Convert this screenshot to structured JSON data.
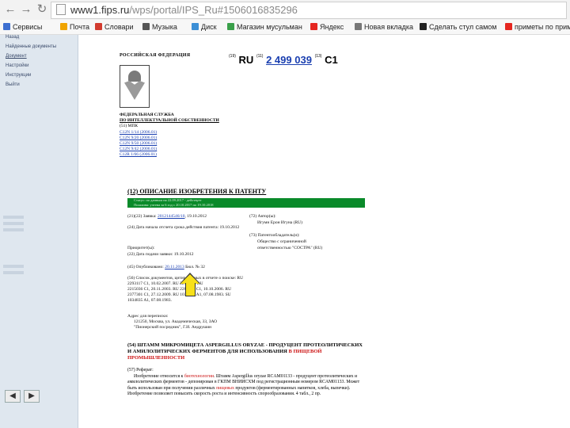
{
  "browser": {
    "url_host": "www1.fips.ru",
    "url_path": "/wps/portal/IPS_Ru#1506016835296",
    "bookmarks": [
      {
        "label": "Сервисы",
        "color": "#3d6fd1"
      },
      {
        "label": "Почта",
        "color": "#f0a400"
      },
      {
        "label": "Словари",
        "color": "#d23b2f"
      },
      {
        "label": "Музыка",
        "color": "#555555"
      },
      {
        "label": "Диск",
        "color": "#3c8fd6"
      },
      {
        "label": "Магазин мусульман",
        "color": "#3aa04a"
      },
      {
        "label": "Яндекс",
        "color": "#e52620"
      },
      {
        "label": "Новая вкладка",
        "color": "#777777"
      },
      {
        "label": "Сделать стул самом",
        "color": "#222222"
      },
      {
        "label": "приметы по прим",
        "color": "#e52620"
      }
    ]
  },
  "sidebar": {
    "items": [
      {
        "label": "Назад"
      },
      {
        "label": "Найденные документы"
      },
      {
        "label": "Документ"
      },
      {
        "label": "Настройки"
      },
      {
        "label": "Инструкции"
      },
      {
        "label": "Выйти"
      }
    ]
  },
  "document": {
    "federation": "РОССИЙСКАЯ ФЕДЕРАЦИЯ",
    "code19": "(19)",
    "country": "RU",
    "code11": "(11)",
    "patent_number": "2 499 039",
    "code13": "(13)",
    "kind": "C1",
    "federal_service_line1": "ФЕДЕРАЛЬНАЯ СЛУЖБА",
    "federal_service_line2": "ПО ИНТЕЛЛЕКТУАЛЬНОЙ СОБСТВЕННОСТИ",
    "mpk_label": "(51) МПК",
    "mpk": [
      "C12N 1/14 (2006.01)",
      "C12N 9/20 (2006.01)",
      "C12N 9/50 (2006.01)",
      "C12N 9/42 (2006.01)",
      "C12R 1/66 (2006.01)"
    ],
    "title": "(12) ОПИСАНИЕ ИЗОБРЕТЕНИЯ К ПАТЕНТУ",
    "status_line1": "Статус: по данным на 22.09.2017 - действует",
    "status_line2": "Пошлина: учтена за 6 год с 20.10.2017 по 19.10.2018",
    "app_label": "(21)(22) Заявка:",
    "app_link": "2012144546/10",
    "app_date": ", 19.10.2012",
    "start_date": "(24) Дата начала отсчета срока действия патента: 19.10.2012",
    "priority": "Приоритет(ы):",
    "filing_date": "(22) Дата подачи заявки: 19.10.2012",
    "pub_label": "(45) Опубликовано:",
    "pub_link": "20.11.2013",
    "pub_bull": "Бюл. № 32",
    "docs_cited_1": "(56) Список документов, цитированных в отчете о поиске: RU 2293117 C1, 10.02.2007. RU 2211599. RU",
    "docs_cited_2": "2215036 C1, 20.11.2003. RU 2285036 C1, 10.10.2006. RU 2377301 C1, 27.12.2009. RU 1034835 A1, 07.08.1983. SU",
    "docs_cited_3": "1034835 A1, 07.08.1983.",
    "address_label": "Адрес для переписки:",
    "address_1": "121250, Москва, ул. Академическая, 33, ЗАО",
    "address_2": "\"Пионерский посредник\", Г.И. Андрушин",
    "authors": "(72) Автор(ы):",
    "author_name": "Игумн Ерон Игуна (RU)",
    "owner_label": "(73) Патентообладатель(и):",
    "owner_1": "Общество с ограниченной",
    "owner_2": "ответственностью \"СОСТРА\" (RU)",
    "title2_black": "(54) ШТАММ МИКРОМИЦЕТА ASPERGILLUS ORYZAE - ПРОДУЦЕНТ ПРОТЕОЛИТИЧЕСКИХ И АМИЛОЛИТИЧЕСКИХ ФЕРМЕНТОВ ДЛЯ ИСПОЛЬЗОВАНИЯ",
    "title2_red": "В ПИЩЕВОЙ ПРОМЫШЛЕННОСТИ",
    "abstract_label": "(57) Реферат:",
    "abstract_a": "Изобретение относится к",
    "abstract_red1": "биотехнологии",
    "abstract_b": ". Штамм Aspergillus oryzae RCAM01133 - продуцент протеолитических и амилолитических ферментов - депонирован в ГКПМ ВНИИСХМ под регистрационным номером RCAM01133. Может быть использован при получении различных",
    "abstract_red2": "пищевых",
    "abstract_c": "продуктов (ферментированных напитков, хлеба, выпечки). Изобретение позволяет повысить скорость роста и интенсивность спорообразования. 4 табл., 2 пр."
  }
}
